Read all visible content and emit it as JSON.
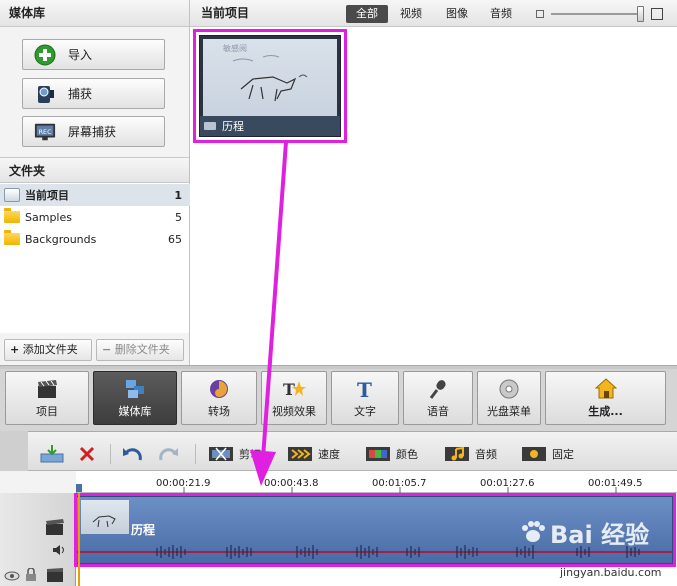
{
  "media_library": {
    "title": "媒体库",
    "import_label": "导入",
    "capture_label": "捕获",
    "screen_capture_label": "屏幕捕获"
  },
  "folders": {
    "title": "文件夹",
    "items": [
      {
        "name": "当前项目",
        "count": "1"
      },
      {
        "name": "Samples",
        "count": "5"
      },
      {
        "name": "Backgrounds",
        "count": "65"
      }
    ],
    "add_label": "添加文件夹",
    "remove_label": "删除文件夹"
  },
  "current_project": {
    "title": "当前项目",
    "filters": [
      "全部",
      "视频",
      "图像",
      "音频"
    ],
    "active_filter": "全部",
    "zoom_level": 1.0,
    "thumb_label": "历程"
  },
  "tabs": [
    {
      "label": "项目",
      "icon": "clapperboard-icon"
    },
    {
      "label": "媒体库",
      "icon": "film-library-icon",
      "active": true
    },
    {
      "label": "转场",
      "icon": "swirl-icon"
    },
    {
      "label": "视频效果",
      "icon": "star-effect-icon"
    },
    {
      "label": "文字",
      "icon": "text-t-icon"
    },
    {
      "label": "语音",
      "icon": "microphone-icon"
    },
    {
      "label": "光盘菜单",
      "icon": "disc-menu-icon"
    },
    {
      "label": "生成...",
      "icon": "house-produce-icon"
    }
  ],
  "timeline_tools": {
    "trim_label": "剪切",
    "speed_label": "速度",
    "color_label": "颜色",
    "audio_label": "音频",
    "pin_label": "固定"
  },
  "ruler": [
    "00:00:21.9",
    "00:00:43.8",
    "00:01:05.7",
    "00:01:27.6",
    "00:01:49.5"
  ],
  "clip": {
    "label": "历程"
  },
  "watermark": {
    "brand": "Bai 经验",
    "url": "jingyan.baidu.com"
  },
  "colors": {
    "highlight": "#e020e0",
    "track": "#5b7fb8",
    "audio_line": "#c8002a"
  }
}
